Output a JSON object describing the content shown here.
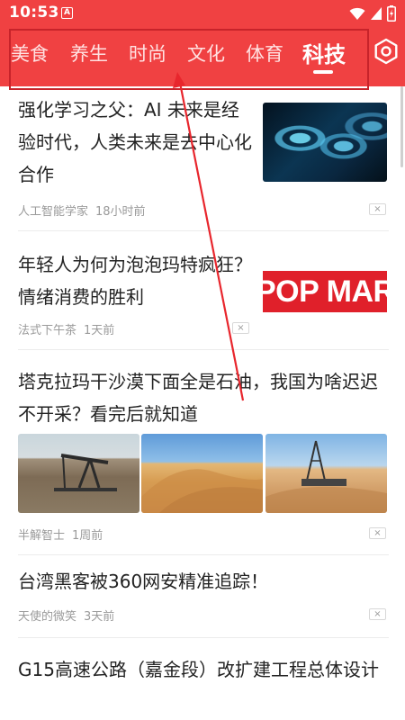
{
  "status_bar": {
    "time": "10:53",
    "notif_letter": "A",
    "icons": [
      "wifi-icon",
      "signal-icon",
      "battery-icon"
    ]
  },
  "tabs": [
    {
      "label": "美食",
      "active": false
    },
    {
      "label": "养生",
      "active": false
    },
    {
      "label": "时尚",
      "active": false
    },
    {
      "label": "文化",
      "active": false
    },
    {
      "label": "体育",
      "active": false
    },
    {
      "label": "科技",
      "active": true
    }
  ],
  "settings_icon": "gear-icon",
  "colors": {
    "header_red": "#f04142",
    "annotation_red": "#c7232a",
    "meta_gray": "#9a9a9a"
  },
  "feed": [
    {
      "title": "强化学习之父：AI 未来是经验时代，人类未来是去中心化合作",
      "source": "人工智能学家",
      "time": "18小时前",
      "dismiss": "×"
    },
    {
      "title": "年轻人为何为泡泡玛特疯狂？情绪消费的胜利",
      "source": "法式下午茶",
      "time": "1天前",
      "image_text": "POP MART",
      "dismiss": "×"
    },
    {
      "title": "塔克拉玛干沙漠下面全是石油，我国为啥迟迟不开采？看完后就知道",
      "source": "半解智士",
      "time": "1周前",
      "dismiss": "×"
    },
    {
      "title": "台湾黑客被360网安精准追踪！",
      "source": "天使的微笑",
      "time": "3天前",
      "dismiss": "×"
    },
    {
      "title": "G15高速公路（嘉金段）改扩建工程总体设计"
    }
  ]
}
